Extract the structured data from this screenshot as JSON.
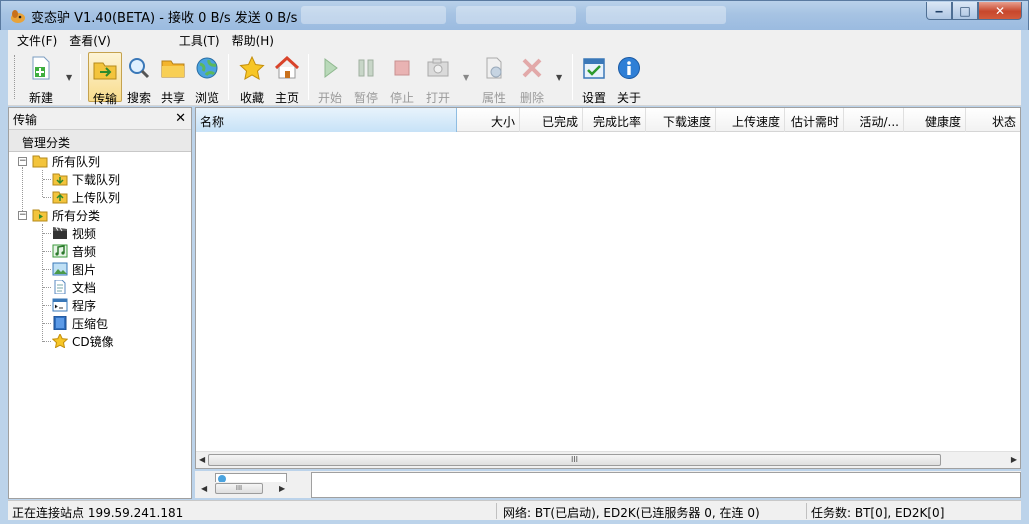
{
  "window": {
    "title": "变态驴 V1.40(BETA) - 接收 0 B/s 发送 0 B/s",
    "minimize": "‒",
    "maximize": "□",
    "close": "✕"
  },
  "menu": [
    {
      "label": "文件(F)"
    },
    {
      "label": "查看(V)"
    },
    {
      "label": "工具(T)"
    },
    {
      "label": "帮助(H)"
    }
  ],
  "toolbar": {
    "new": "新建",
    "transfer": "传输",
    "search": "搜索",
    "share": "共享",
    "browse": "浏览",
    "favorites": "收藏",
    "home": "主页",
    "start": "开始",
    "pause": "暂停",
    "stop": "停止",
    "open": "打开",
    "properties": "属性",
    "delete": "删除",
    "settings": "设置",
    "about": "关于"
  },
  "left_panel": {
    "title": "传输",
    "close": "✕",
    "subheader": "管理分类",
    "tree": {
      "all_queues": "所有队列",
      "download_queue": "下载队列",
      "upload_queue": "上传队列",
      "all_categories": "所有分类",
      "video": "视频",
      "audio": "音频",
      "pictures": "图片",
      "documents": "文档",
      "programs": "程序",
      "archives": "压缩包",
      "cd_images": "CD镜像"
    },
    "expander_collapse": "−"
  },
  "columns": [
    "名称",
    "大小",
    "已完成",
    "完成比率",
    "下载速度",
    "上传速度",
    "估计需时",
    "活动/...",
    "健康度",
    "状态"
  ],
  "scroll": {
    "grip": "III",
    "left_arrow": "◀",
    "right_arrow": "▶"
  },
  "status": {
    "connecting": "正在连接站点 199.59.241.181",
    "network": "网络: BT(已启动), ED2K(已连服务器 0, 在连 0)",
    "tasks": "任务数: BT[0], ED2K[0]"
  },
  "colors": {
    "accent": "#c7e2f7",
    "active_button": "#f8dc8c",
    "close": "#c7472c"
  }
}
